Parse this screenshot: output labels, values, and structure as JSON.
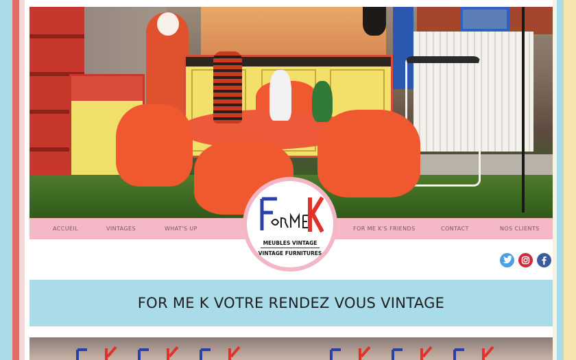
{
  "nav": {
    "items": [
      "Accueil",
      "Vintages",
      "What's up",
      "For me K's friends",
      "Contact",
      "Nos clients"
    ]
  },
  "logo": {
    "wordmark": "For me K",
    "line1": "MEUBLES VINTAGE",
    "line2": "VINTAGE FURNITURES"
  },
  "social": [
    {
      "name": "twitter",
      "color": "#4aa0e6"
    },
    {
      "name": "instagram",
      "color": "#d02a3a"
    },
    {
      "name": "facebook",
      "color": "#3b5c9c"
    }
  ],
  "banner": {
    "title": "FOR ME K VOTRE RENDEZ VOUS VINTAGE"
  },
  "colors": {
    "nav_pink": "#f5b8c6",
    "banner_blue": "#a9dbe9",
    "stripe_red": "#e86a6a",
    "stripe_yellow": "#f5e6b0"
  }
}
